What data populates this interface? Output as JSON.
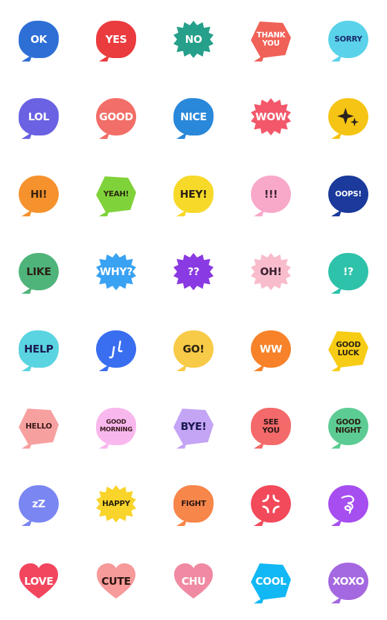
{
  "stickers": [
    {
      "text": "OK",
      "color": "#2e6fd6",
      "ink": "#ffffff",
      "shape": "cloud"
    },
    {
      "text": "YES",
      "color": "#ea3b3e",
      "ink": "#ffffff",
      "shape": "cloud"
    },
    {
      "text": "NO",
      "color": "#26a08a",
      "ink": "#ffffff",
      "shape": "burst"
    },
    {
      "text": "THANK\nYOU",
      "color": "#f06258",
      "ink": "#ffffff",
      "shape": "hex"
    },
    {
      "text": "SORRY",
      "color": "#5ad2ea",
      "ink": "#1a2a6a",
      "shape": "round"
    },
    {
      "text": "LOL",
      "color": "#6a62e2",
      "ink": "#ffffff",
      "shape": "cloud"
    },
    {
      "text": "GOOD",
      "color": "#f26e68",
      "ink": "#ffffff",
      "shape": "round"
    },
    {
      "text": "NICE",
      "color": "#2a88da",
      "ink": "#ffffff",
      "shape": "cloud"
    },
    {
      "text": "WOW",
      "color": "#f2586a",
      "ink": "#ffffff",
      "shape": "burst"
    },
    {
      "text": "",
      "icon": "sparkle-icon",
      "color": "#f6c414",
      "ink": "#2a2320",
      "shape": "round"
    },
    {
      "text": "HI!",
      "color": "#f6922e",
      "ink": "#3a2410",
      "shape": "round"
    },
    {
      "text": "YEAH!",
      "color": "#80d23a",
      "ink": "#2a2a10",
      "shape": "hex"
    },
    {
      "text": "HEY!",
      "color": "#f7d92a",
      "ink": "#2a2210",
      "shape": "cloud"
    },
    {
      "text": "!!!",
      "color": "#f8a9c9",
      "ink": "#3a2030",
      "shape": "round"
    },
    {
      "text": "OOPS!",
      "color": "#1b3a9c",
      "ink": "#ffffff",
      "shape": "round"
    },
    {
      "text": "LIKE",
      "color": "#4fb47a",
      "ink": "#2a2015",
      "shape": "round"
    },
    {
      "text": "WHY?",
      "color": "#3aa2f2",
      "ink": "#ffffff",
      "shape": "burst"
    },
    {
      "text": "??",
      "color": "#8a3ae2",
      "ink": "#ffffff",
      "shape": "burst"
    },
    {
      "text": "OH!",
      "color": "#f8bccc",
      "ink": "#3a2030",
      "shape": "burst"
    },
    {
      "text": "!?",
      "color": "#2ec2aa",
      "ink": "#ffffff",
      "shape": "round"
    },
    {
      "text": "HELP",
      "color": "#5ad4e0",
      "ink": "#1a1a50",
      "shape": "cloud"
    },
    {
      "text": "",
      "icon": "sweat-drops-icon",
      "color": "#3a6ef0",
      "ink": "#ffffff",
      "shape": "round"
    },
    {
      "text": "GO!",
      "color": "#f7ca48",
      "ink": "#2a2210",
      "shape": "round"
    },
    {
      "text": "WW",
      "color": "#f7822a",
      "ink": "#ffffff",
      "shape": "round"
    },
    {
      "text": "GOOD\nLUCK",
      "color": "#f7cc14",
      "ink": "#2a2210",
      "shape": "hex"
    },
    {
      "text": "HELLO",
      "color": "#f7a0a0",
      "ink": "#3a1a1a",
      "shape": "hex"
    },
    {
      "text": "GOOD\nMORNING",
      "color": "#f8b8ee",
      "ink": "#3a1a1a",
      "shape": "cloud"
    },
    {
      "text": "BYE!",
      "color": "#c4a4f4",
      "ink": "#1a1a50",
      "shape": "hex"
    },
    {
      "text": "SEE\nYOU",
      "color": "#f46a6a",
      "ink": "#2a1515",
      "shape": "cloud"
    },
    {
      "text": "GOOD\nNIGHT",
      "color": "#5ccc94",
      "ink": "#2a1a10",
      "shape": "round"
    },
    {
      "text": "zZ",
      "color": "#7a86f2",
      "ink": "#ffffff",
      "shape": "round"
    },
    {
      "text": "HAPPY",
      "color": "#f9d42a",
      "ink": "#2a2210",
      "shape": "burst"
    },
    {
      "text": "FIGHT",
      "color": "#f7864a",
      "ink": "#2a1510",
      "shape": "cloud"
    },
    {
      "text": "",
      "icon": "anger-icon",
      "color": "#f24a5a",
      "ink": "#ffffff",
      "shape": "round"
    },
    {
      "text": "",
      "icon": "swirl-icon",
      "color": "#a64ef0",
      "ink": "#ffffff",
      "shape": "round"
    },
    {
      "text": "LOVE",
      "color": "#f2465e",
      "ink": "#ffffff",
      "shape": "heart"
    },
    {
      "text": "CUTE",
      "color": "#f79a9a",
      "ink": "#2a1510",
      "shape": "heart"
    },
    {
      "text": "CHU",
      "color": "#f08aa2",
      "ink": "#ffffff",
      "shape": "heart"
    },
    {
      "text": "COOL",
      "color": "#12b8f4",
      "ink": "#ffffff",
      "shape": "hex"
    },
    {
      "text": "XOXO",
      "color": "#a468e0",
      "ink": "#ffffff",
      "shape": "round"
    }
  ]
}
